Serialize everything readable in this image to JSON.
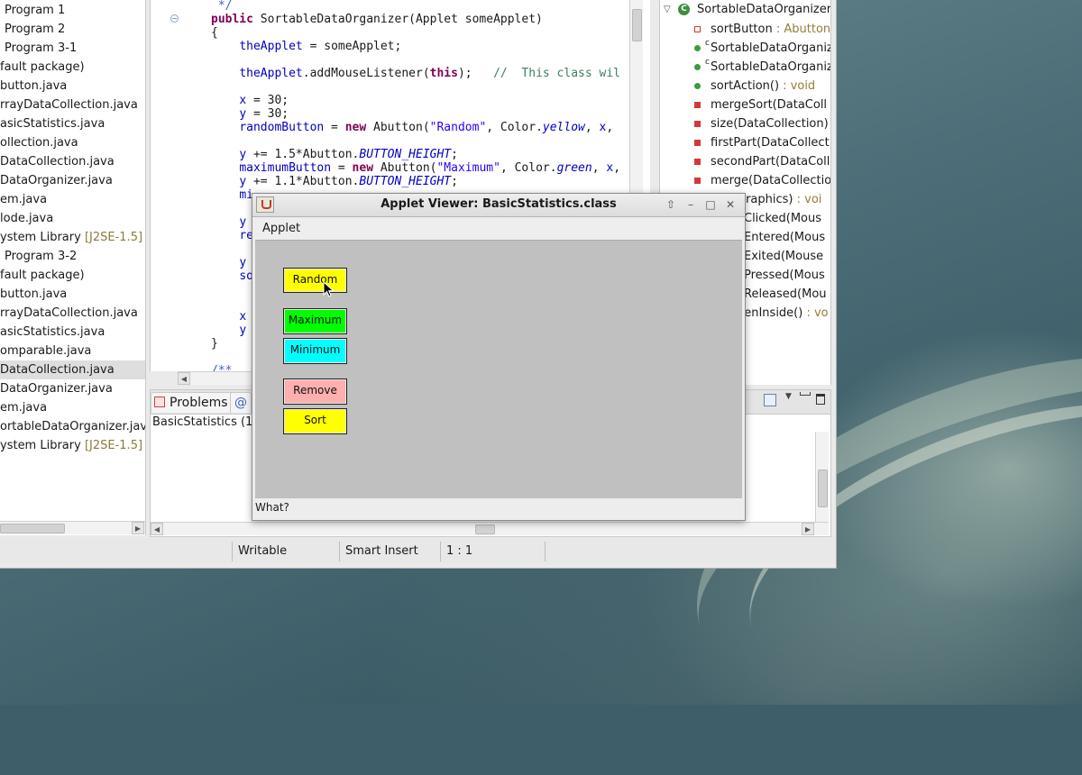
{
  "package_explorer": {
    "items": [
      {
        "label": "Program 1",
        "indent": true
      },
      {
        "label": "Program 2",
        "indent": true
      },
      {
        "label": "Program 3-1",
        "indent": true
      },
      {
        "label": "fault package)"
      },
      {
        "label": "button.java"
      },
      {
        "label": "rrayDataCollection.java"
      },
      {
        "label": "asicStatistics.java"
      },
      {
        "label": "ollection.java"
      },
      {
        "label": "DataCollection.java"
      },
      {
        "label": "DataOrganizer.java"
      },
      {
        "label": "em.java"
      },
      {
        "label": "lode.java"
      },
      {
        "label": "ystem Library ",
        "lib": "[J2SE-1.5]"
      },
      {
        "label": "Program 3-2",
        "indent": true
      },
      {
        "label": "fault package)"
      },
      {
        "label": "button.java"
      },
      {
        "label": "rrayDataCollection.java"
      },
      {
        "label": "asicStatistics.java"
      },
      {
        "label": "omparable.java"
      },
      {
        "label": "DataCollection.java",
        "selected": true
      },
      {
        "label": "DataOrganizer.java"
      },
      {
        "label": "em.java"
      },
      {
        "label": "ortableDataOrganizer.java"
      },
      {
        "label": "ystem Library ",
        "lib": "[J2SE-1.5]"
      }
    ]
  },
  "editor": {
    "fold_icon": "minus-circle-icon",
    "lines": [
      [
        {
          "t": " */",
          "c": "jdoc"
        }
      ],
      [
        {
          "t": "public ",
          "c": "kw"
        },
        {
          "t": "SortableDataOrganizer(Applet someApplet)"
        }
      ],
      [
        {
          "t": "{"
        }
      ],
      [
        {
          "t": "    "
        },
        {
          "t": "theApplet",
          "c": "fld"
        },
        {
          "t": " = someApplet;"
        }
      ],
      [
        {
          "t": ""
        }
      ],
      [
        {
          "t": "    "
        },
        {
          "t": "theApplet",
          "c": "fld"
        },
        {
          "t": ".addMouseListener("
        },
        {
          "t": "this",
          "c": "kw"
        },
        {
          "t": ");   "
        },
        {
          "t": "//  This class wil",
          "c": "cmt"
        }
      ],
      [
        {
          "t": ""
        }
      ],
      [
        {
          "t": "    "
        },
        {
          "t": "x",
          "c": "fld"
        },
        {
          "t": " = 30;"
        }
      ],
      [
        {
          "t": "    "
        },
        {
          "t": "y",
          "c": "fld"
        },
        {
          "t": " = 30;"
        }
      ],
      [
        {
          "t": "    "
        },
        {
          "t": "randomButton",
          "c": "fld"
        },
        {
          "t": " = "
        },
        {
          "t": "new ",
          "c": "kw"
        },
        {
          "t": "Abutton("
        },
        {
          "t": "\"Random\"",
          "c": "str"
        },
        {
          "t": ", Color."
        },
        {
          "t": "yellow",
          "c": "ital"
        },
        {
          "t": ", "
        },
        {
          "t": "x",
          "c": "fld"
        },
        {
          "t": ","
        }
      ],
      [
        {
          "t": ""
        }
      ],
      [
        {
          "t": "    "
        },
        {
          "t": "y",
          "c": "fld"
        },
        {
          "t": " += 1.5*Abutton."
        },
        {
          "t": "BUTTON_HEIGHT",
          "c": "ital"
        },
        {
          "t": ";"
        }
      ],
      [
        {
          "t": "    "
        },
        {
          "t": "maximumButton",
          "c": "fld"
        },
        {
          "t": " = "
        },
        {
          "t": "new ",
          "c": "kw"
        },
        {
          "t": "Abutton("
        },
        {
          "t": "\"Maximum\"",
          "c": "str"
        },
        {
          "t": ", Color."
        },
        {
          "t": "green",
          "c": "ital"
        },
        {
          "t": ", "
        },
        {
          "t": "x",
          "c": "fld"
        },
        {
          "t": ","
        }
      ],
      [
        {
          "t": "    "
        },
        {
          "t": "y",
          "c": "fld"
        },
        {
          "t": " += 1.1*Abutton."
        },
        {
          "t": "BUTTON_HEIGHT",
          "c": "ital"
        },
        {
          "t": ";"
        }
      ],
      [
        {
          "t": "    "
        },
        {
          "t": "mi",
          "c": "fld"
        }
      ],
      [
        {
          "t": ""
        }
      ],
      [
        {
          "t": "    "
        },
        {
          "t": "y",
          "c": "fld"
        }
      ],
      [
        {
          "t": "    "
        },
        {
          "t": "re",
          "c": "fld"
        }
      ],
      [
        {
          "t": ""
        }
      ],
      [
        {
          "t": "    "
        },
        {
          "t": "y",
          "c": "fld"
        }
      ],
      [
        {
          "t": "    "
        },
        {
          "t": "so",
          "c": "fld"
        }
      ],
      [
        {
          "t": ""
        }
      ],
      [
        {
          "t": ""
        }
      ],
      [
        {
          "t": "    "
        },
        {
          "t": "x",
          "c": "fld"
        }
      ],
      [
        {
          "t": "    "
        },
        {
          "t": "y",
          "c": "fld"
        }
      ],
      [
        {
          "t": "}"
        }
      ],
      [
        {
          "t": ""
        }
      ],
      [
        {
          "t": "/**",
          "c": "jdoc"
        }
      ]
    ]
  },
  "outline": {
    "class_name": "SortableDataOrganizer",
    "class_icon": "class-icon",
    "items": [
      {
        "label": "sortButton",
        "type": " : Abutton",
        "vis": "field"
      },
      {
        "label": "SortableDataOrganiz",
        "vis": "pub",
        "ctor": "c"
      },
      {
        "label": "SortableDataOrganiz",
        "vis": "pub",
        "ctor": "c"
      },
      {
        "label": "sortAction()",
        "type": " : void",
        "vis": "pub"
      },
      {
        "label": "mergeSort(DataColl",
        "vis": "priv"
      },
      {
        "label": "size(DataCollection)",
        "vis": "priv"
      },
      {
        "label": "firstPart(DataCollect",
        "vis": "priv"
      },
      {
        "label": "secondPart(DataColl",
        "vis": "priv"
      },
      {
        "label": "merge(DataCollectio",
        "vis": "priv"
      },
      {
        "label": "Graphics)",
        "type": " : voi",
        "vis": "none"
      },
      {
        "label": "eClicked(Mous",
        "vis": "none"
      },
      {
        "label": "eEntered(Mous",
        "vis": "none"
      },
      {
        "label": "eExited(Mouse",
        "vis": "none"
      },
      {
        "label": "ePressed(Mous",
        "vis": "none"
      },
      {
        "label": "eReleased(Mou",
        "vis": "none"
      },
      {
        "label": "henInside()",
        "type": " : vo",
        "vis": "none"
      }
    ]
  },
  "problems": {
    "tab_label": "Problems",
    "tab2_label": "@",
    "content": "BasicStatistics (1",
    "right_fragment": ")"
  },
  "statusbar": {
    "writable": "Writable",
    "insert_mode": "Smart Insert",
    "position": "1 : 1"
  },
  "applet_viewer": {
    "title": "Applet Viewer: BasicStatistics.class",
    "menu": "Applet",
    "status": "What?",
    "window_buttons": {
      "up": "⇧",
      "min": "–",
      "max": "□",
      "close": "✕"
    },
    "buttons": [
      {
        "label": "Random",
        "color": "#ffff00"
      },
      {
        "label": "Maximum",
        "color": "#00ff00"
      },
      {
        "label": "Minimum",
        "color": "#00ffff"
      },
      {
        "label": "Remove",
        "color": "#ffafaf"
      },
      {
        "label": "Sort",
        "color": "#ffff00"
      }
    ]
  }
}
